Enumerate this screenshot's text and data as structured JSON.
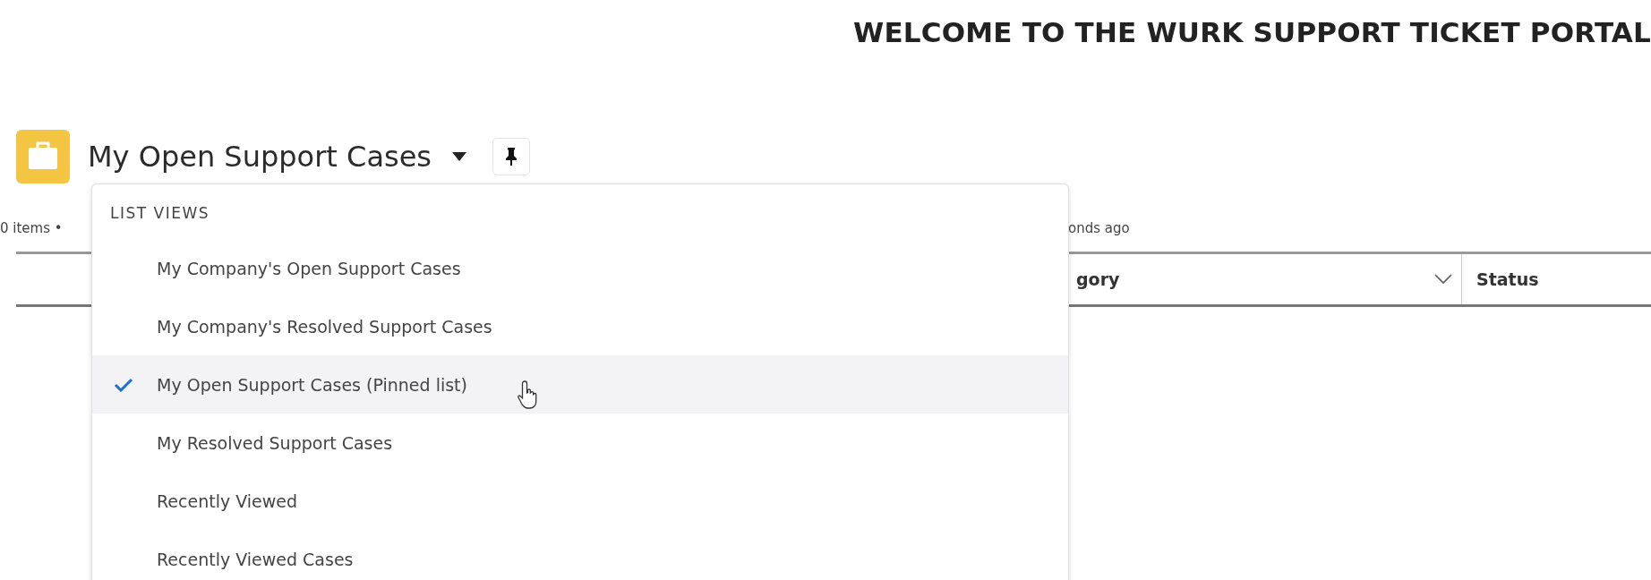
{
  "header": {
    "title": "WELCOME TO THE WURK SUPPORT TICKET PORTAL"
  },
  "list_header": {
    "title": "My Open Support Cases"
  },
  "list_meta": {
    "item_count": "0 items •",
    "updated": "onds ago"
  },
  "table": {
    "columns": [
      {
        "label": "gory",
        "menu": true
      },
      {
        "label": "Status",
        "menu": false
      }
    ]
  },
  "dropdown": {
    "heading": "LIST VIEWS",
    "items": [
      {
        "label": "My Company's Open Support Cases",
        "selected": false
      },
      {
        "label": "My Company's Resolved Support Cases",
        "selected": false
      },
      {
        "label": "My Open Support Cases (Pinned list)",
        "selected": true
      },
      {
        "label": "My Resolved Support Cases",
        "selected": false
      },
      {
        "label": "Recently Viewed",
        "selected": false
      },
      {
        "label": "Recently Viewed Cases",
        "selected": false
      }
    ]
  }
}
